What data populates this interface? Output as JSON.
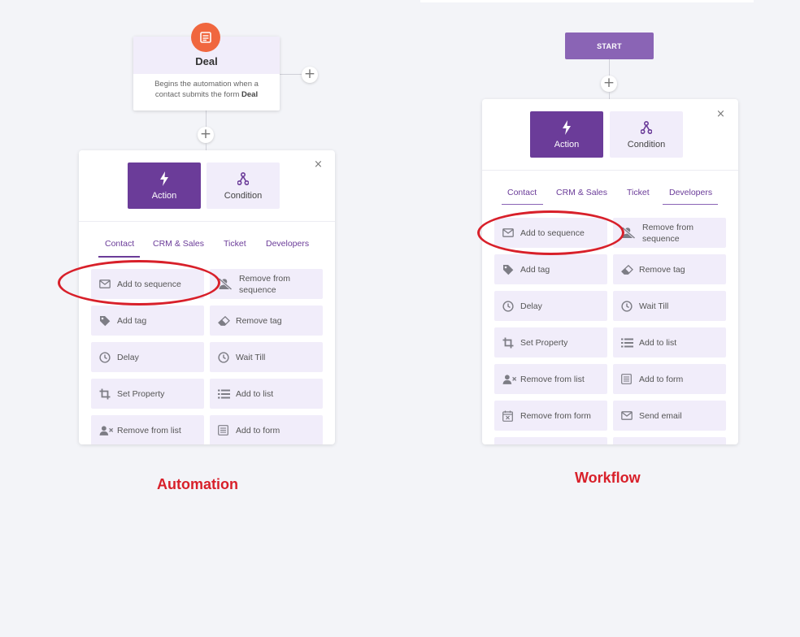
{
  "deal_node": {
    "title": "Deal",
    "desc_prefix": "Begins the automation when a contact submits the form",
    "desc_bold": "Deal"
  },
  "start_node": {
    "label": "START"
  },
  "automation_panel": {
    "action_label": "Action",
    "condition_label": "Condition",
    "close": "×",
    "tabs": [
      "Contact",
      "CRM & Sales",
      "Ticket",
      "Developers"
    ],
    "options": [
      {
        "label": "Add to sequence",
        "icon": "envelope-icon"
      },
      {
        "label": "Remove from sequence",
        "icon": "user-slash-icon"
      },
      {
        "label": "Add tag",
        "icon": "tag-icon"
      },
      {
        "label": "Remove tag",
        "icon": "eraser-icon"
      },
      {
        "label": "Delay",
        "icon": "clock-icon"
      },
      {
        "label": "Wait Till",
        "icon": "clock-icon"
      },
      {
        "label": "Set Property",
        "icon": "crop-icon"
      },
      {
        "label": "Add to list",
        "icon": "list-icon"
      },
      {
        "label": "Remove from list",
        "icon": "user-x-icon"
      },
      {
        "label": "Add to form",
        "icon": "form-icon"
      }
    ]
  },
  "workflow_panel": {
    "action_label": "Action",
    "condition_label": "Condition",
    "close": "×",
    "tabs": [
      "Contact",
      "CRM & Sales",
      "Ticket",
      "Developers"
    ],
    "options": [
      {
        "label": "Add to sequence",
        "icon": "envelope-icon"
      },
      {
        "label": "Remove from sequence",
        "icon": "user-slash-icon"
      },
      {
        "label": "Add tag",
        "icon": "tag-icon"
      },
      {
        "label": "Remove tag",
        "icon": "eraser-icon"
      },
      {
        "label": "Delay",
        "icon": "clock-icon"
      },
      {
        "label": "Wait Till",
        "icon": "clock-icon"
      },
      {
        "label": "Set Property",
        "icon": "crop-icon"
      },
      {
        "label": "Add to list",
        "icon": "list-icon"
      },
      {
        "label": "Remove from list",
        "icon": "user-x-icon"
      },
      {
        "label": "Add to form",
        "icon": "form-icon"
      },
      {
        "label": "Remove from form",
        "icon": "calendar-x-icon"
      },
      {
        "label": "Send email",
        "icon": "envelope-icon"
      }
    ]
  },
  "captions": {
    "left": "Automation",
    "right": "Workflow"
  },
  "plus_symbol": "+",
  "colors": {
    "accent": "#6b3c99",
    "annotation": "#d8202a",
    "deal_icon": "#f0673f",
    "option_bg": "#f1edfa"
  }
}
